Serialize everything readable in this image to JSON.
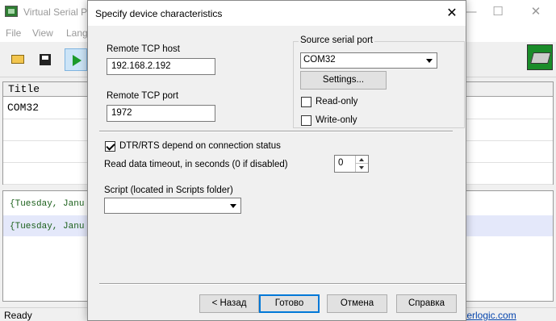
{
  "main_window": {
    "title": "Virtual Serial Po",
    "controls": {
      "minimize": "—",
      "maximize": "☐",
      "close": "✕"
    },
    "menu": [
      "File",
      "View",
      "Langu"
    ],
    "toolbar": {
      "icons": [
        "open-folder-icon",
        "save-icon",
        "start-icon",
        "network-port-icon"
      ]
    },
    "ports_table": {
      "column_title": "Title",
      "rows": [
        "COM32",
        "",
        "",
        ""
      ]
    },
    "log": [
      "{Tuesday, Janu",
      "{Tuesday, Janu"
    ],
    "status": {
      "text": "Ready",
      "link": "terlogic.com"
    }
  },
  "dialog": {
    "title": "Specify device characteristics",
    "close_glyph": "✕",
    "remote_host": {
      "label": "Remote TCP host",
      "value": "192.168.2.192"
    },
    "remote_port": {
      "label": "Remote TCP port",
      "value": "1972"
    },
    "source_serial": {
      "caption": "Source serial port",
      "selected": "COM32",
      "settings_button": "Settings...",
      "read_only": {
        "label": "Read-only",
        "checked": false
      },
      "write_only": {
        "label": "Write-only",
        "checked": false
      }
    },
    "dtr_rts": {
      "label": "DTR/RTS depend on connection status",
      "checked": true
    },
    "timeout": {
      "label": "Read data timeout, in seconds (0 if disabled)",
      "value": "0"
    },
    "script": {
      "label": "Script (located in Scripts folder)",
      "selected": ""
    },
    "buttons": {
      "back": "< Назад",
      "finish": "Готово",
      "cancel": "Отмена",
      "help": "Справка"
    }
  },
  "colors": {
    "accent": "#0078d7",
    "log_text": "#1a5f1a",
    "log_highlight": "#e4e8fa",
    "link": "#0645ad"
  }
}
